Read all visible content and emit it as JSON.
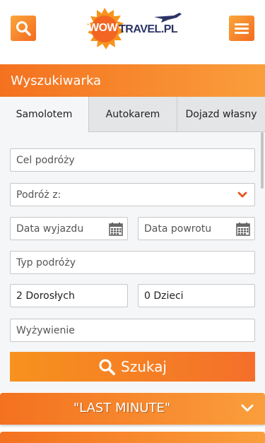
{
  "header": {
    "logo_text": "TRAVEL.PL",
    "logo_wow": "WOW",
    "search_icon": "search-icon",
    "menu_icon": "hamburger-menu-icon"
  },
  "search_panel": {
    "title": "Wyszukiwarka",
    "tabs": [
      {
        "label": "Samolotem",
        "active": true
      },
      {
        "label": "Autokarem",
        "active": false
      },
      {
        "label": "Dojazd własny",
        "active": false
      }
    ],
    "fields": {
      "destination_placeholder": "Cel podróży",
      "departure_from_label": "Podróż z:",
      "departure_date_placeholder": "Data wyjazdu",
      "return_date_placeholder": "Data powrotu",
      "trip_type_placeholder": "Typ podróży",
      "adults_value": "2 Dorosłych",
      "children_value": "0 Dzieci",
      "board_placeholder": "Wyżywienie"
    },
    "search_button_label": "Szukaj"
  },
  "last_minute": {
    "label": "\"LAST MINUTE\""
  },
  "colors": {
    "accent_orange": "#f4711f",
    "accent_light": "#fa9e3c",
    "chevron_red": "#e8541e",
    "logo_navy": "#2c3466"
  }
}
